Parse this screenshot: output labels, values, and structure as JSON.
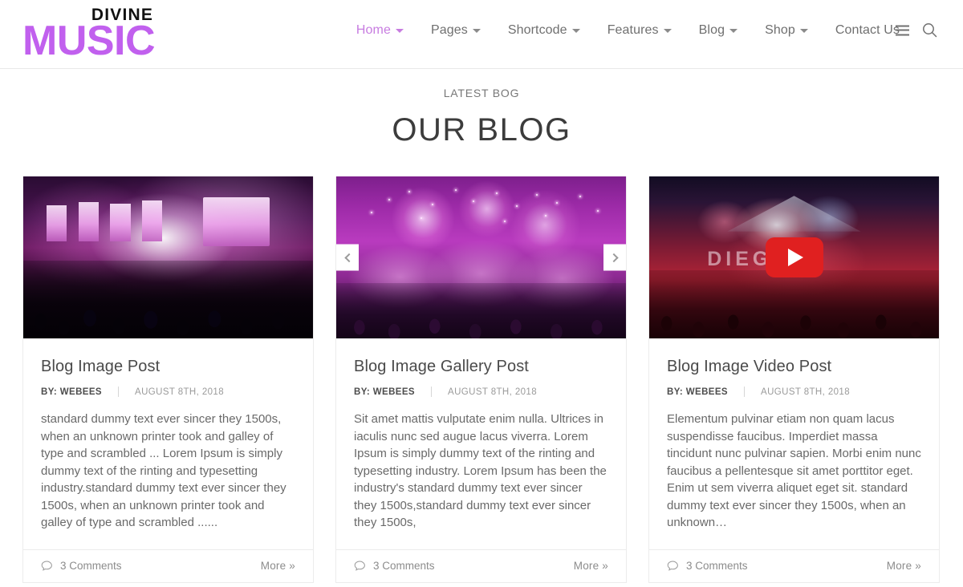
{
  "brand": {
    "top_word": "DIVINE",
    "bottom_word": "MUSIC",
    "accent_color": "#c160ee"
  },
  "nav": {
    "items": [
      {
        "label": "Home",
        "has_caret": true,
        "active": true
      },
      {
        "label": "Pages",
        "has_caret": true,
        "active": false
      },
      {
        "label": "Shortcode",
        "has_caret": true,
        "active": false
      },
      {
        "label": "Features",
        "has_caret": true,
        "active": false
      },
      {
        "label": "Blog",
        "has_caret": true,
        "active": false
      },
      {
        "label": "Shop",
        "has_caret": true,
        "active": false
      },
      {
        "label": "Contact Us",
        "has_caret": false,
        "active": false
      }
    ],
    "menu_icon": "hamburger-icon",
    "search_icon": "search-icon",
    "active_color": "#c77ce0"
  },
  "section": {
    "eyebrow": "LATEST BOG",
    "title": "OUR BLOG"
  },
  "posts": [
    {
      "title": "Blog Image Post",
      "author": "BY: WEBEES",
      "date": "AUGUST 8TH, 2018",
      "excerpt": "standard dummy text ever sincer they 1500s, when an unknown printer took and galley of type and scrambled ... Lorem Ipsum is simply dummy text of the rinting and typesetting industry.standard dummy text ever sincer they 1500s, when an unknown printer took and galley of type and scrambled ......",
      "comments": "3 Comments",
      "more": "More »",
      "media_type": "image"
    },
    {
      "title": "Blog Image Gallery Post",
      "author": "BY: WEBEES",
      "date": "AUGUST 8TH, 2018",
      "excerpt": "Sit amet mattis vulputate enim nulla. Ultrices in iaculis nunc sed augue lacus viverra. Lorem Ipsum is simply dummy text of the rinting and typesetting industry. Lorem Ipsum has been the industry's standard dummy text ever sincer they 1500s,standard dummy text ever sincer they 1500s,",
      "comments": "3 Comments",
      "more": "More »",
      "media_type": "gallery"
    },
    {
      "title": "Blog Image Video Post",
      "author": "BY: WEBEES",
      "date": "AUGUST 8TH, 2018",
      "excerpt": "Elementum pulvinar etiam non quam lacus suspendisse faucibus. Imperdiet massa tincidunt nunc pulvinar sapien. Morbi enim nunc faucibus a pellentesque sit amet porttitor eget. Enim ut sem viverra aliquet eget sit. standard dummy text ever sincer they 1500s, when an unknown…",
      "comments": "3 Comments",
      "more": "More »",
      "media_type": "video",
      "stage_text": "DIEG"
    }
  ],
  "carousel": {
    "prev_icon": "chevron-left-icon",
    "next_icon": "chevron-right-icon"
  },
  "video": {
    "play_icon": "play-icon",
    "play_color": "#e02020"
  },
  "comment_icon": "comment-bubble-icon"
}
